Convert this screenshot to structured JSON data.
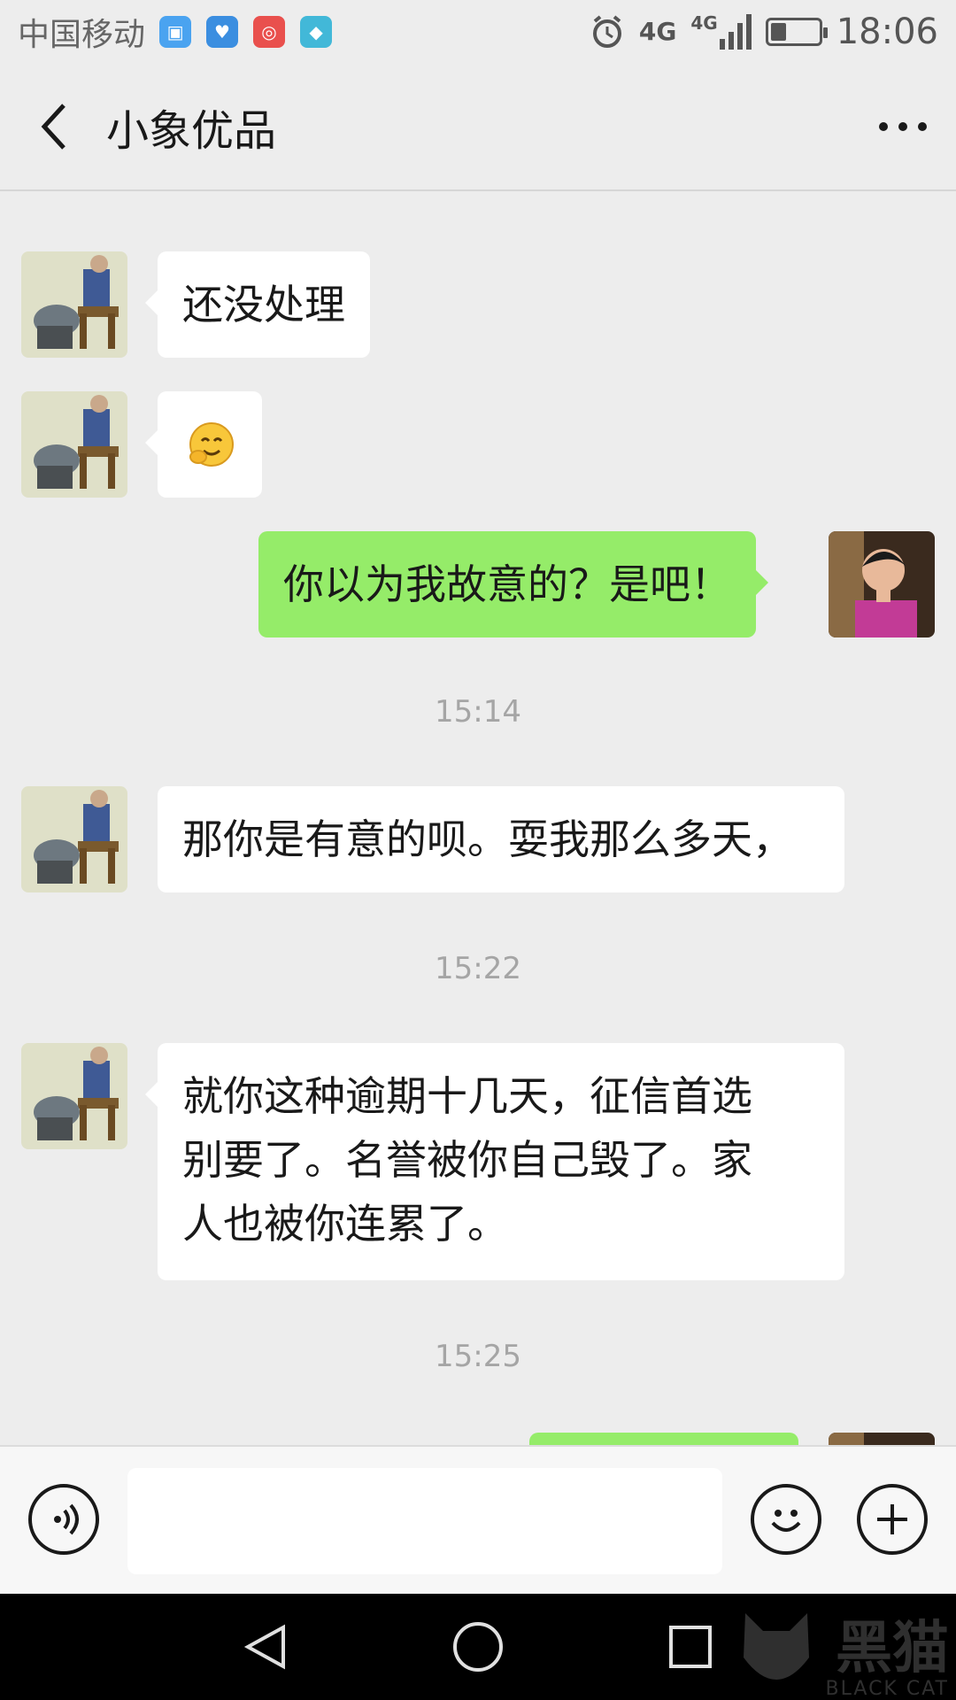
{
  "status_bar": {
    "carrier": "中国移动",
    "network_1": "4G",
    "network_2": "4G",
    "battery_level": 0.3,
    "time": "18:06",
    "app_icons": [
      "photo-icon",
      "health-icon",
      "weibo-icon",
      "shield-icon"
    ]
  },
  "header": {
    "title": "小象优品",
    "back_icon": "chevron-left-icon",
    "more_icon": "more-dots-icon"
  },
  "messages": [
    {
      "sender": "other",
      "type": "text",
      "text": "还没处理"
    },
    {
      "sender": "other",
      "type": "emoji",
      "emoji": "🤗"
    },
    {
      "sender": "me",
      "type": "text",
      "text": "你以为我故意的？是吧！"
    },
    {
      "type": "time",
      "text": "15:14"
    },
    {
      "sender": "other",
      "type": "text",
      "text": "那你是有意的呗。耍我那么多天，"
    },
    {
      "type": "time",
      "text": "15:22"
    },
    {
      "sender": "other",
      "type": "text",
      "lines": [
        "就你这种逾期十几天，征信首选",
        "别要了。名誉被你自己毁了。家",
        "人也被你连累了。"
      ]
    },
    {
      "type": "time",
      "text": "15:25"
    }
  ],
  "input_bar": {
    "voice_icon": "voice-icon",
    "input_value": "",
    "emoji_icon": "smiley-icon",
    "add_icon": "plus-icon"
  },
  "nav_bar": {
    "icons": [
      "back-triangle-icon",
      "home-circle-icon",
      "recents-square-icon"
    ]
  },
  "watermark": {
    "text": "黑猫",
    "sub": "BLACK CAT"
  },
  "colors": {
    "background": "#ededed",
    "outgoing_bubble": "#95ec69",
    "incoming_bubble": "#ffffff",
    "timestamp": "#a5a5a5"
  }
}
